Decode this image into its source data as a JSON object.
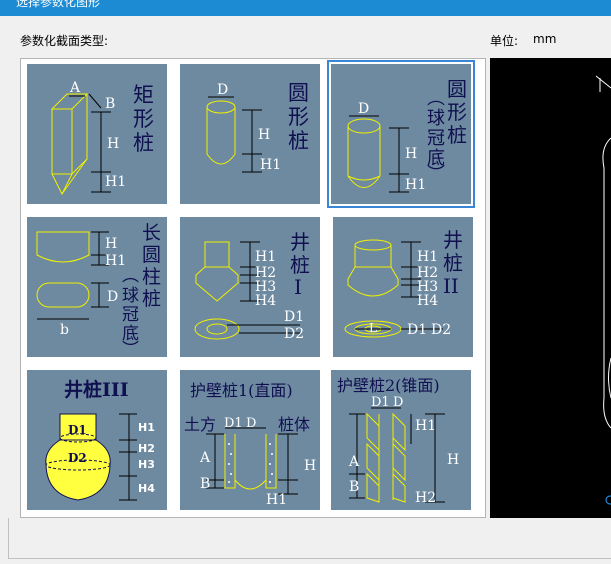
{
  "window": {
    "title": "选择参数化图形"
  },
  "header": {
    "section_type_label": "参数化截面类型:",
    "unit_label": "单位:",
    "unit_value": "mm"
  },
  "tiles": [
    {
      "name": "矩形桩",
      "labels": [
        "A",
        "B",
        "H",
        "H1"
      ]
    },
    {
      "name": "圆形桩",
      "labels": [
        "D",
        "H",
        "H1"
      ]
    },
    {
      "name": "圆形桩(球冠底)",
      "labels": [
        "D",
        "H",
        "H1"
      ],
      "selected": true
    },
    {
      "name": "长圆柱桩(球冠底)",
      "labels": [
        "H",
        "H1",
        "D",
        "b"
      ]
    },
    {
      "name": "井桩I",
      "labels": [
        "H1",
        "H2",
        "H3",
        "H4",
        "D1",
        "D2"
      ]
    },
    {
      "name": "井桩II",
      "labels": [
        "H1",
        "H2",
        "H3",
        "H4",
        "L",
        "D1",
        "D2"
      ]
    },
    {
      "name": "井桩III",
      "labels": [
        "D1",
        "D2",
        "H1",
        "H2",
        "H3",
        "H4"
      ]
    },
    {
      "name": "护壁桩1(直面)",
      "labels": [
        "土方",
        "D1",
        "D",
        "桩体",
        "A",
        "B",
        "H",
        "H1"
      ]
    },
    {
      "name": "护壁桩2(锥面)",
      "labels": [
        "D1",
        "D",
        "H1",
        "A",
        "B",
        "H",
        "H2"
      ]
    }
  ],
  "colors": {
    "tile_bg": "#6e8aa1",
    "drawing": "#f0f000",
    "title_text": "#101050",
    "selection": "#3a86d6",
    "titlebar": "#1c8bd3"
  }
}
